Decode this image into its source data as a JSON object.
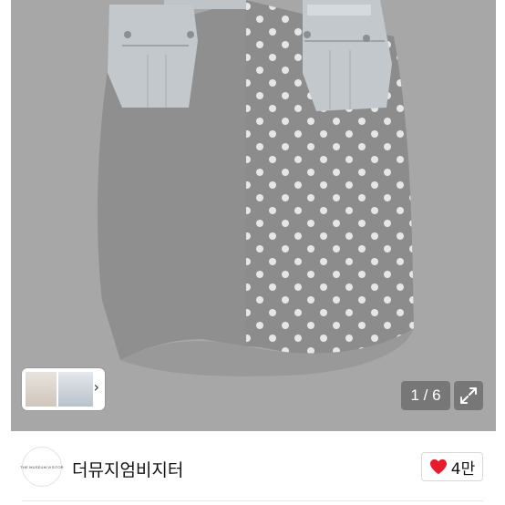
{
  "gallery": {
    "counter": "1 / 6",
    "thumbnail_nav_icon": "chevron-right-icon",
    "expand_icon": "expand-icon"
  },
  "seller": {
    "avatar_text": "THE MUSEUM VISITOR",
    "name": "더뮤지엄비지터"
  },
  "like": {
    "icon": "heart-icon",
    "count": "4만",
    "color": "#e51c2c"
  }
}
